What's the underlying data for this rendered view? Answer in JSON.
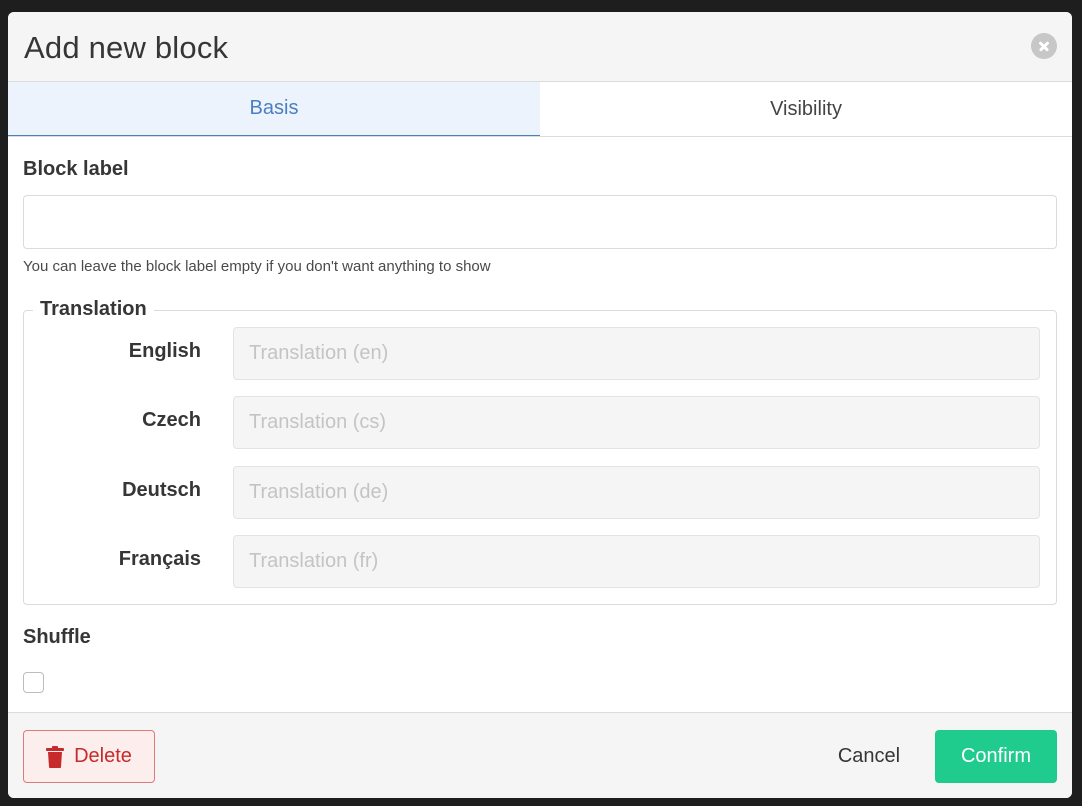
{
  "modal": {
    "title": "Add new block"
  },
  "tabs": [
    {
      "label": "Basis",
      "active": true
    },
    {
      "label": "Visibility",
      "active": false
    }
  ],
  "block_label": {
    "label": "Block label",
    "value": "",
    "help": "You can leave the block label empty if you don't want anything to show"
  },
  "translation": {
    "legend": "Translation",
    "rows": [
      {
        "language": "English",
        "placeholder": "Translation (en)"
      },
      {
        "language": "Czech",
        "placeholder": "Translation (cs)"
      },
      {
        "language": "Deutsch",
        "placeholder": "Translation (de)"
      },
      {
        "language": "Français",
        "placeholder": "Translation (fr)"
      }
    ]
  },
  "shuffle": {
    "label": "Shuffle",
    "checked": false
  },
  "footer": {
    "delete_label": "Delete",
    "cancel_label": "Cancel",
    "confirm_label": "Confirm"
  },
  "colors": {
    "accent_tab": "#4a7fc1",
    "confirm": "#1fcc8e",
    "delete": "#c62a2a"
  },
  "icons": {
    "close": "close-icon",
    "delete": "trash-icon"
  }
}
